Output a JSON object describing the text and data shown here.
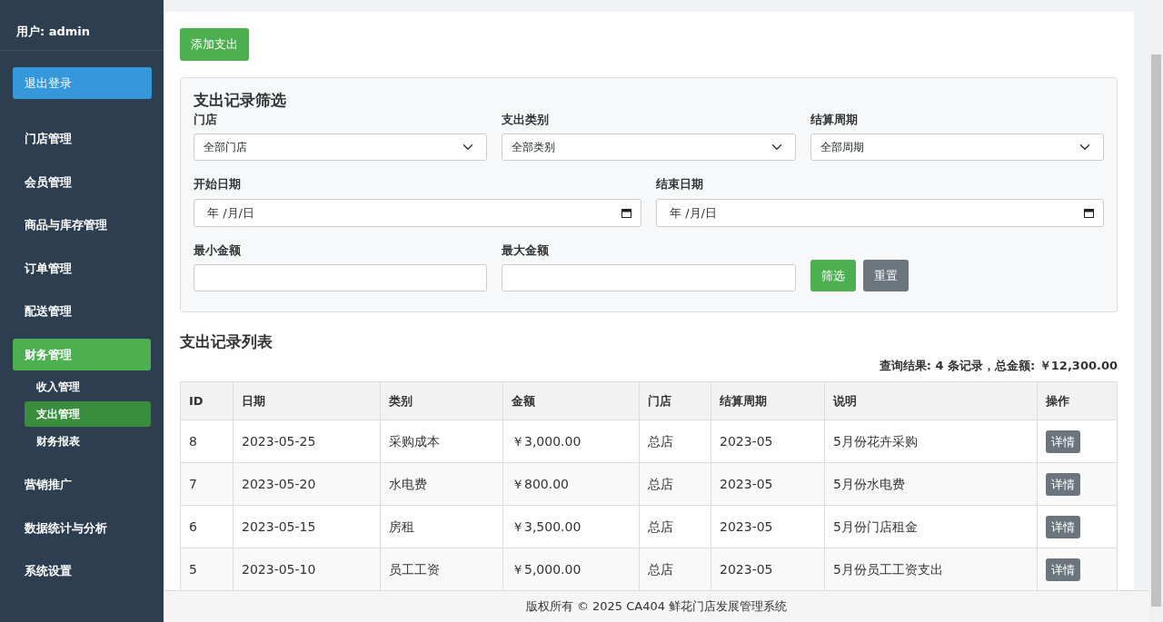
{
  "sidebar": {
    "user": "用户: admin",
    "logout": "退出登录",
    "items": [
      {
        "label": "门店管理",
        "selected": false
      },
      {
        "label": "会员管理",
        "selected": false
      },
      {
        "label": "商品与库存管理",
        "selected": false
      },
      {
        "label": "订单管理",
        "selected": false
      },
      {
        "label": "配送管理",
        "selected": false
      },
      {
        "label": "财务管理",
        "selected": true,
        "children": [
          {
            "label": "收入管理",
            "selected": false
          },
          {
            "label": "支出管理",
            "selected": true
          },
          {
            "label": "财务报表",
            "selected": false
          }
        ]
      },
      {
        "label": "营销推广",
        "selected": false
      },
      {
        "label": "数据统计与分析",
        "selected": false
      },
      {
        "label": "系统设置",
        "selected": false
      }
    ]
  },
  "add_button": "添加支出",
  "filter": {
    "title": "支出记录筛选",
    "selects": [
      {
        "label": "门店",
        "value": "全部门店"
      },
      {
        "label": "支出类别",
        "value": "全部类别"
      },
      {
        "label": "结算周期",
        "value": "全部周期"
      }
    ],
    "dates": [
      {
        "label": "开始日期",
        "value": "年 /月/日"
      },
      {
        "label": "结束日期",
        "value": "年 /月/日"
      }
    ],
    "amounts": [
      {
        "label": "最小金额"
      },
      {
        "label": "最大金额"
      }
    ],
    "filter_button": "筛选",
    "reset_button": "重置"
  },
  "list": {
    "title": "支出记录列表",
    "summary": "查询结果: 4 条记录，总金额: ￥12,300.00",
    "columns": [
      "ID",
      "日期",
      "类别",
      "金额",
      "门店",
      "结算周期",
      "说明",
      "操作"
    ],
    "rows": [
      [
        "8",
        "2023-05-25",
        "采购成本",
        "￥3,000.00",
        "总店",
        "2023-05",
        "5月份花卉采购",
        "详情"
      ],
      [
        "7",
        "2023-05-20",
        "水电费",
        "￥800.00",
        "总店",
        "2023-05",
        "5月份水电费",
        "详情"
      ],
      [
        "6",
        "2023-05-15",
        "房租",
        "￥3,500.00",
        "总店",
        "2023-05",
        "5月份门店租金",
        "详情"
      ],
      [
        "5",
        "2023-05-10",
        "员工工资",
        "￥5,000.00",
        "总店",
        "2023-05",
        "5月份员工工资支出",
        "详情"
      ]
    ]
  },
  "footer": "版权所有 © 2025 CA404 鲜花门店发展管理系统"
}
